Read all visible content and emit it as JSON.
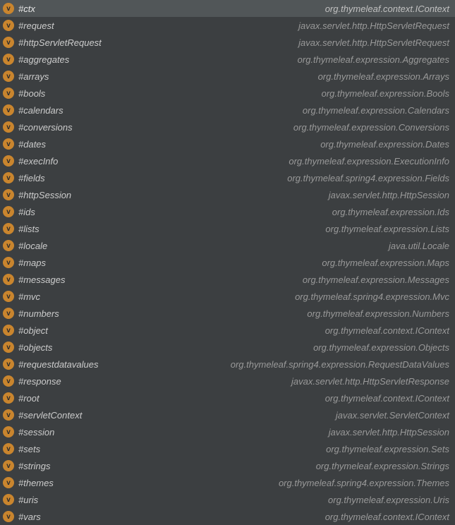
{
  "iconLetter": "v",
  "items": [
    {
      "label": "#ctx",
      "type": "org.thymeleaf.context.IContext",
      "selected": true
    },
    {
      "label": "#request",
      "type": "javax.servlet.http.HttpServletRequest",
      "selected": false
    },
    {
      "label": "#httpServletRequest",
      "type": "javax.servlet.http.HttpServletRequest",
      "selected": false
    },
    {
      "label": "#aggregates",
      "type": "org.thymeleaf.expression.Aggregates",
      "selected": false
    },
    {
      "label": "#arrays",
      "type": "org.thymeleaf.expression.Arrays",
      "selected": false
    },
    {
      "label": "#bools",
      "type": "org.thymeleaf.expression.Bools",
      "selected": false
    },
    {
      "label": "#calendars",
      "type": "org.thymeleaf.expression.Calendars",
      "selected": false
    },
    {
      "label": "#conversions",
      "type": "org.thymeleaf.expression.Conversions",
      "selected": false
    },
    {
      "label": "#dates",
      "type": "org.thymeleaf.expression.Dates",
      "selected": false
    },
    {
      "label": "#execInfo",
      "type": "org.thymeleaf.expression.ExecutionInfo",
      "selected": false
    },
    {
      "label": "#fields",
      "type": "org.thymeleaf.spring4.expression.Fields",
      "selected": false
    },
    {
      "label": "#httpSession",
      "type": "javax.servlet.http.HttpSession",
      "selected": false
    },
    {
      "label": "#ids",
      "type": "org.thymeleaf.expression.Ids",
      "selected": false
    },
    {
      "label": "#lists",
      "type": "org.thymeleaf.expression.Lists",
      "selected": false
    },
    {
      "label": "#locale",
      "type": "java.util.Locale",
      "selected": false
    },
    {
      "label": "#maps",
      "type": "org.thymeleaf.expression.Maps",
      "selected": false
    },
    {
      "label": "#messages",
      "type": "org.thymeleaf.expression.Messages",
      "selected": false
    },
    {
      "label": "#mvc",
      "type": "org.thymeleaf.spring4.expression.Mvc",
      "selected": false
    },
    {
      "label": "#numbers",
      "type": "org.thymeleaf.expression.Numbers",
      "selected": false
    },
    {
      "label": "#object",
      "type": "org.thymeleaf.context.IContext",
      "selected": false
    },
    {
      "label": "#objects",
      "type": "org.thymeleaf.expression.Objects",
      "selected": false
    },
    {
      "label": "#requestdatavalues",
      "type": "org.thymeleaf.spring4.expression.RequestDataValues",
      "selected": false
    },
    {
      "label": "#response",
      "type": "javax.servlet.http.HttpServletResponse",
      "selected": false
    },
    {
      "label": "#root",
      "type": "org.thymeleaf.context.IContext",
      "selected": false
    },
    {
      "label": "#servletContext",
      "type": "javax.servlet.ServletContext",
      "selected": false
    },
    {
      "label": "#session",
      "type": "javax.servlet.http.HttpSession",
      "selected": false
    },
    {
      "label": "#sets",
      "type": "org.thymeleaf.expression.Sets",
      "selected": false
    },
    {
      "label": "#strings",
      "type": "org.thymeleaf.expression.Strings",
      "selected": false
    },
    {
      "label": "#themes",
      "type": "org.thymeleaf.spring4.expression.Themes",
      "selected": false
    },
    {
      "label": "#uris",
      "type": "org.thymeleaf.expression.Uris",
      "selected": false
    },
    {
      "label": "#vars",
      "type": "org.thymeleaf.context.IContext",
      "selected": false
    }
  ]
}
